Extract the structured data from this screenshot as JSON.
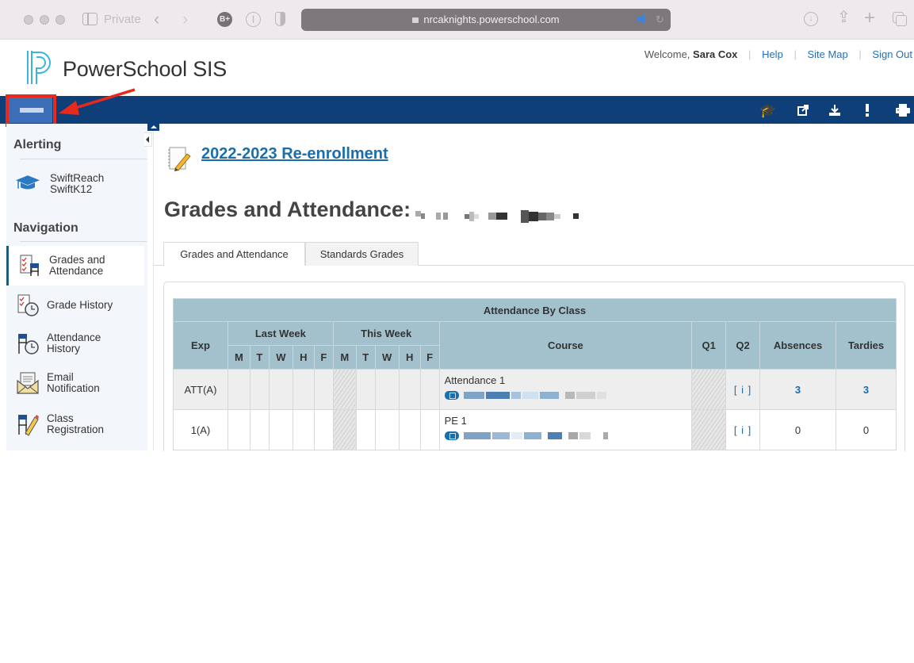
{
  "browser": {
    "private_label": "Private",
    "url": "nrcaknights.powerschool.com",
    "icons": [
      "sidebar-icon",
      "back-icon",
      "forward-icon",
      "bplus-extension-icon",
      "password-extension-icon",
      "shield-icon",
      "lock-icon",
      "speaker-icon",
      "reload-icon",
      "download-icon",
      "share-icon",
      "new-tab-icon",
      "tabs-icon"
    ]
  },
  "header": {
    "app_name": "PowerSchool SIS",
    "welcome_prefix": "Welcome,",
    "user_name": "Sara Cox",
    "links": [
      "Help",
      "Site Map",
      "Sign Out"
    ]
  },
  "navbar": {
    "menu_button_label": "Menu",
    "icons": [
      "graduation-cap-icon",
      "external-link-icon",
      "download-icon",
      "alert-icon",
      "print-icon"
    ],
    "brand_color": "#0f3f78",
    "highlight_color": "#e8291c"
  },
  "sidebar": {
    "alerting_heading": "Alerting",
    "alerting_items": [
      {
        "line1": "SwiftReach",
        "line2": "SwiftK12",
        "icon": "graduation-cap-icon"
      }
    ],
    "navigation_heading": "Navigation",
    "nav_items": [
      {
        "line1": "Grades and",
        "line2": "Attendance",
        "icon": "grades-attendance-icon",
        "active": true
      },
      {
        "line1": "Grade History",
        "line2": "",
        "icon": "grade-history-icon",
        "active": false
      },
      {
        "line1": "Attendance",
        "line2": "History",
        "icon": "attendance-history-icon",
        "active": false
      },
      {
        "line1": "Email",
        "line2": "Notification",
        "icon": "email-notification-icon",
        "active": false
      },
      {
        "line1": "Class",
        "line2": "Registration",
        "icon": "class-registration-icon",
        "active": false
      }
    ]
  },
  "main": {
    "reenroll_link": "2022-2023 Re-enrollment",
    "page_title": "Grades and Attendance:",
    "student_name_redacted": true,
    "tabs": [
      {
        "label": "Grades and Attendance",
        "active": true
      },
      {
        "label": "Standards Grades",
        "active": false
      }
    ],
    "table": {
      "caption": "Attendance By Class",
      "col_exp": "Exp",
      "last_week": "Last Week",
      "this_week": "This Week",
      "days": [
        "M",
        "T",
        "W",
        "H",
        "F"
      ],
      "col_course": "Course",
      "col_q1": "Q1",
      "col_q2": "Q2",
      "col_absences": "Absences",
      "col_tardies": "Tardies",
      "rows": [
        {
          "exp": "ATT(A)",
          "course": "Attendance 1",
          "teacher_redacted": true,
          "q2": "[ i ]",
          "absences": "3",
          "tardies": "3",
          "counts_linked": true
        },
        {
          "exp": "1(A)",
          "course": "PE 1",
          "teacher_redacted": true,
          "q2": "[ i ]",
          "absences": "0",
          "tardies": "0",
          "counts_linked": false
        }
      ]
    }
  }
}
